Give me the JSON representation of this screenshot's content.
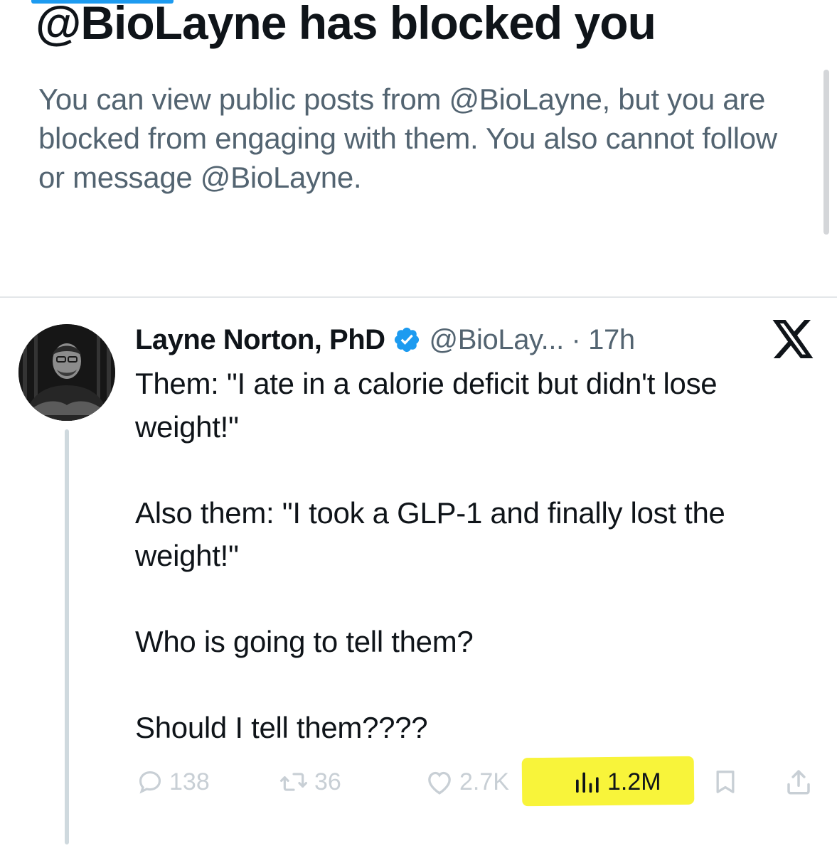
{
  "block_notice": {
    "title": "@BioLayne has blocked you",
    "description": "You can view public posts from @BioLayne, but you are blocked from engaging with them. You also cannot follow or message @BioLayne."
  },
  "tweet": {
    "author_name": "Layne Norton, PhD",
    "handle_and_time": "@BioLay... · 17h",
    "paragraphs": [
      "Them: \"I ate in a calorie deficit but didn't lose weight!\"",
      "Also them: \"I took a GLP-1 and finally lost the weight!\"",
      "Who is going to tell them?",
      "Should I tell them????"
    ],
    "stats": {
      "replies": "138",
      "reposts": "36",
      "likes": "2.7K",
      "views": "1.2M"
    }
  },
  "colors": {
    "text_primary": "#0f1419",
    "text_secondary": "#536471",
    "verified_blue": "#1d9bf0",
    "highlight_yellow": "#f8f43a",
    "faded_action": "#c8cfd5"
  },
  "icons": {
    "verified": "verified-badge-icon",
    "platform": "x-logo-icon",
    "reply": "reply-icon",
    "repost": "repost-icon",
    "like": "heart-icon",
    "views": "views-bar-chart-icon",
    "bookmark": "bookmark-icon",
    "share": "share-icon"
  }
}
